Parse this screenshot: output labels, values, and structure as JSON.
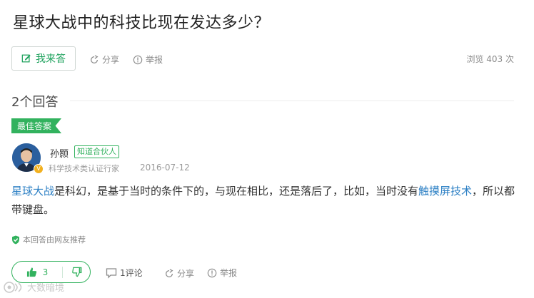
{
  "question": {
    "title": "星球大战中的科技比现在发达多少？"
  },
  "toolbar": {
    "answer_label": "我来答",
    "share_label": "分享",
    "report_label": "举报",
    "views_label": "浏览 403 次"
  },
  "answers_header": {
    "count_label": "2个回答"
  },
  "best_answer": {
    "badge": "最佳答案",
    "author": {
      "name": "孙颢",
      "tag": "知道合伙人",
      "title": "科学技术类认证行家",
      "date": "2016-07-12",
      "badge_letter": "V"
    },
    "text": {
      "kw1": "星球大战",
      "part1": "是科幻，是基于当时的条件下的，与现在相比，还是落后了，比如，当时没有",
      "kw2": "触摸屏技术",
      "part2": "，所以都带键盘。"
    },
    "recommend_label": "本回答由网友推荐",
    "actions": {
      "like_count": "3",
      "comment_label": "1评论",
      "share_label": "分享",
      "report_label": "举报"
    }
  },
  "watermark": {
    "text": "大数暗境"
  },
  "colors": {
    "green": "#32b25e",
    "link": "#2b7fc4",
    "gray": "#8a8a8a"
  }
}
